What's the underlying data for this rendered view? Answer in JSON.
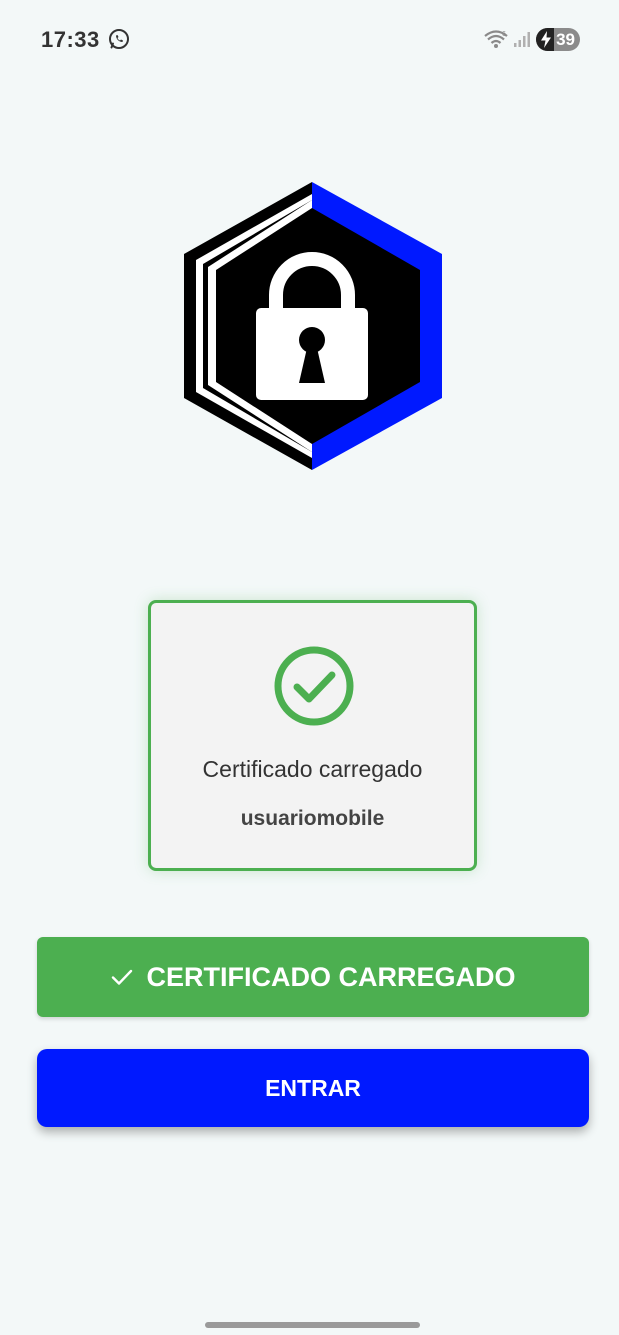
{
  "status_bar": {
    "time": "17:33",
    "battery_level": "39",
    "icons": [
      "whatsapp-icon",
      "wifi-icon",
      "signal-icon",
      "battery-icon",
      "charging-bolt-icon"
    ]
  },
  "logo": {
    "icon": "padlock-hexagon-logo",
    "colors": {
      "outer_left": "#000000",
      "outer_right": "#0019ff",
      "inner_stripe": "#ffffff",
      "lock": "#ffffff"
    }
  },
  "certificate_card": {
    "icon": "check-circle-icon",
    "status_text": "Certificado carregado",
    "username": "usuariomobile",
    "border_color": "#4caf50"
  },
  "buttons": {
    "certificate_label": "CERTIFICADO CARREGADO",
    "certificate_color": "#4caf50",
    "enter_label": "ENTRAR",
    "enter_color": "#0019ff"
  },
  "colors": {
    "background": "#f3f8f8",
    "success": "#4caf50",
    "primary": "#0019ff"
  }
}
